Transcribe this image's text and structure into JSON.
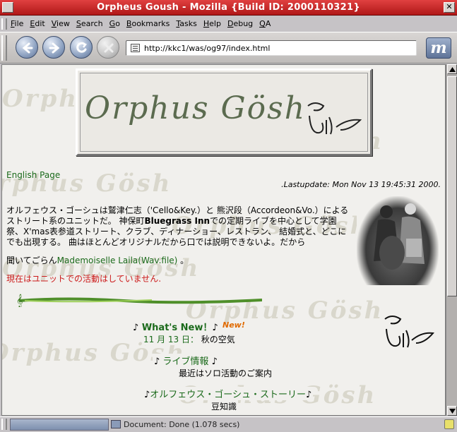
{
  "window": {
    "title": "Orpheus Goush - Mozilla {Build ID: 2000110321}"
  },
  "menubar": {
    "items": [
      {
        "underline": "F",
        "rest": "ile"
      },
      {
        "underline": "E",
        "rest": "dit"
      },
      {
        "underline": "V",
        "rest": "iew"
      },
      {
        "underline": "S",
        "rest": "earch"
      },
      {
        "underline": "G",
        "rest": "o"
      },
      {
        "underline": "B",
        "rest": "ookmarks"
      },
      {
        "underline": "T",
        "rest": "asks"
      },
      {
        "underline": "H",
        "rest": "elp"
      },
      {
        "underline": "D",
        "rest": "ebug"
      },
      {
        "underline": "Q",
        "rest": "A"
      }
    ]
  },
  "navbar": {
    "url": "http://kkc1/was/og97/index.html"
  },
  "page": {
    "banner_logo": "Orphus  Gösh",
    "english_link": "English Page",
    "lastupdate": ".Lastupdate: Mon Nov 13 19:45:31 2000.",
    "intro_part1": "オルフェウス・ゴーシュは鷲津仁志（'Cello&Key.）と 熊沢段（Accordeon&Vo.）によるストリート系のユニットだ。 神保町",
    "intro_bold": "Bluegrass Inn",
    "intro_part2": "での定期ライブを中心として学園祭、X'mas表参道ストリート、クラブ、ディナーショー、レストラン、 結婚式と、どこにでも出現する。 曲はほとんどオリジナルだから口では説明できないよ。だから",
    "listen_prefix": "聞いてごらん",
    "listen_link": "Mademoiselle Laila(Wav.file)",
    "listen_suffix": " 。",
    "notice": "現在はユニットでの活動はしていません.",
    "whats_new_note_left": "♪",
    "whats_new": " What's New！",
    "whats_new_note_right": "♪",
    "new_badge": "New!",
    "date_label": "11 月 13 日：",
    "date_text": " 秋の空気",
    "live_note_left": "♪",
    "live_label": " ライブ情報 ",
    "live_note_right": "♪",
    "live_sub": "最近はソロ活動のご案内",
    "story_note_left": "♪",
    "story_label": "オルフェウス・ゴーシュ・ストーリー",
    "story_note_right": "♪",
    "story_sub": "豆知識",
    "bg_word": "Orphus  Gösh"
  },
  "status": {
    "text": "Document: Done (1.078 secs)"
  },
  "colors": {
    "titlebar": "#c82424",
    "link_green": "#1b6a1b",
    "notice_red": "#cc1a1a",
    "new_orange": "#e06a00",
    "page_bg": "#f1f0ed"
  }
}
